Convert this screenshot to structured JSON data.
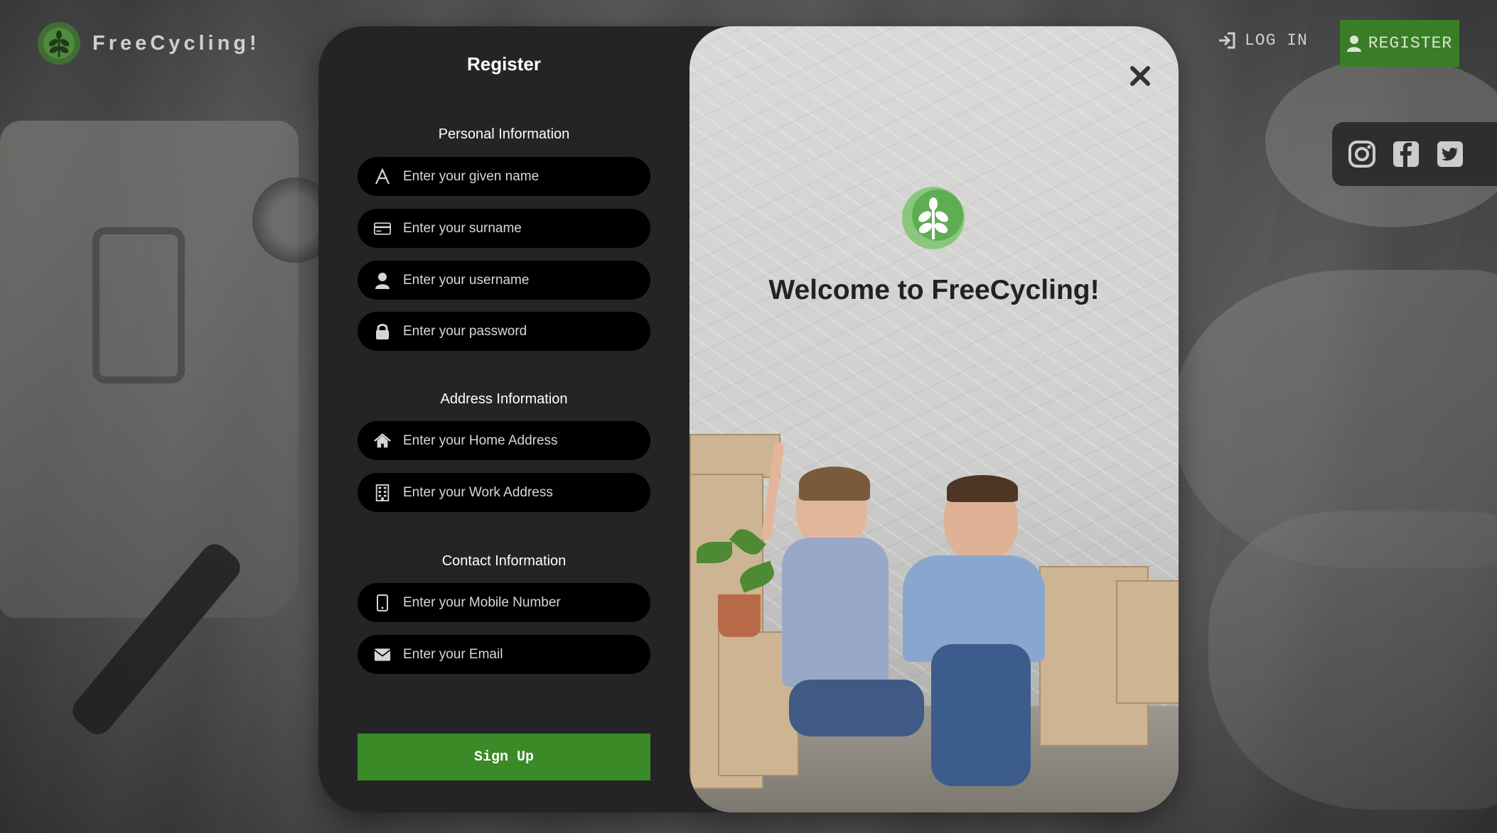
{
  "header": {
    "brand": "FreeCycling!",
    "login_label": "LOG IN",
    "register_label": "REGISTER"
  },
  "social": [
    "instagram-icon",
    "facebook-icon",
    "twitter-icon"
  ],
  "form": {
    "title": "Register",
    "sections": {
      "personal": "Personal Information",
      "address": "Address Information",
      "contact": "Contact Information"
    },
    "fields": {
      "given_name": "Enter your given name",
      "surname": "Enter your surname",
      "username": "Enter your username",
      "password": "Enter your password",
      "home_address": "Enter your Home Address",
      "work_address": "Enter your Work Address",
      "mobile": "Enter your Mobile Number",
      "email": "Enter your Email"
    },
    "submit_label": "Sign Up"
  },
  "welcome": {
    "title": "Welcome to FreeCycling!"
  },
  "colors": {
    "accent": "#3a8a28",
    "modal_bg": "#242427",
    "field_bg": "#000000"
  }
}
